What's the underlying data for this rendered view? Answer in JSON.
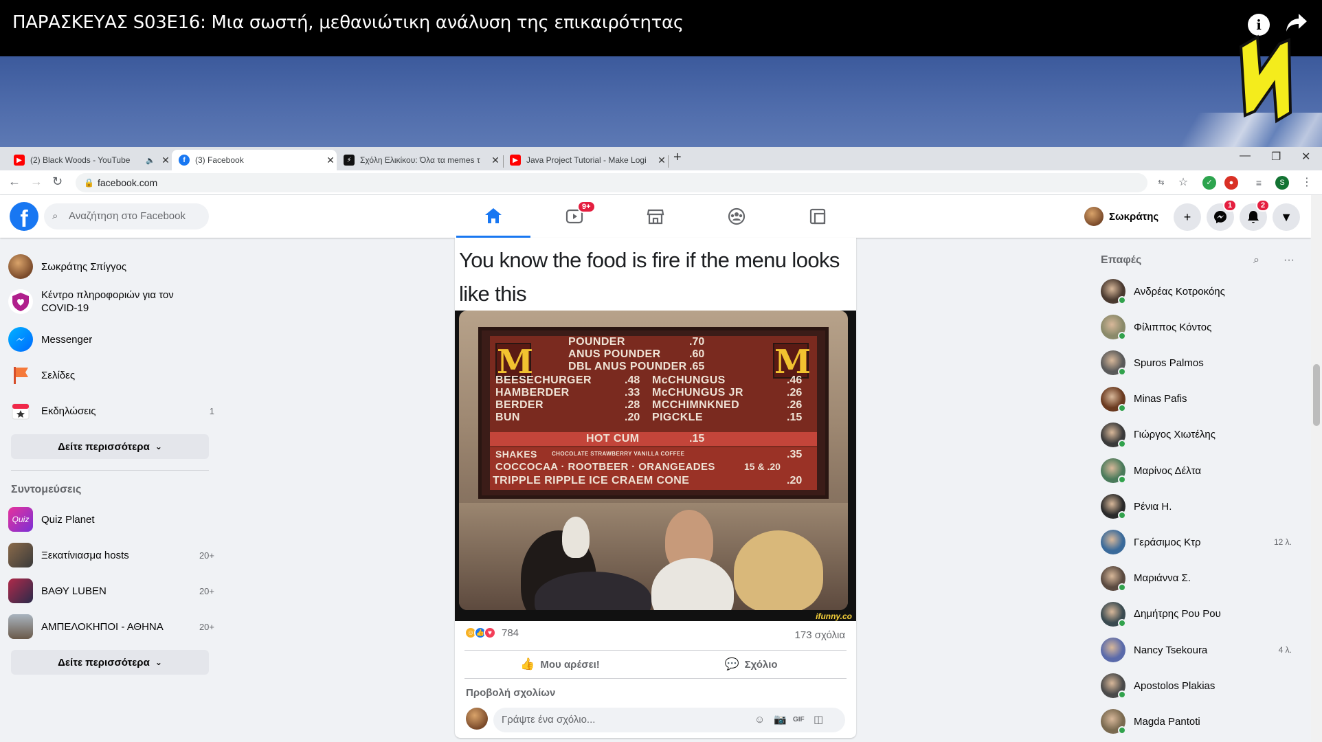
{
  "video": {
    "title": "ΠΑΡΑΣΚΕΥΑΣ S03E16: Μια σωστή, μεθανιώτικη ανάλυση της επικαιρότητας",
    "info_icon": "i",
    "share_icon": "share-arrow"
  },
  "browser": {
    "tabs": [
      {
        "title": "(2) Black Woods - YouTube",
        "icon": "youtube",
        "audio": true
      },
      {
        "title": "(3) Facebook",
        "icon": "facebook",
        "active": true
      },
      {
        "title": "Σχόλη Ελικίκου: Όλα τα memes τ",
        "icon": "bolt"
      },
      {
        "title": "Java Project Tutorial - Make Logi",
        "icon": "youtube"
      }
    ],
    "url": "facebook.com",
    "profile_initial": "S"
  },
  "fb": {
    "search_placeholder": "Αναζήτηση στο Facebook",
    "watch_badge": "9+",
    "profile_name": "Σωκράτης",
    "messenger_badge": "1",
    "notifications_badge": "2"
  },
  "left": {
    "items": [
      {
        "label": "Σωκράτης Σπίγγος"
      },
      {
        "label": "Κέντρο πληροφοριών για τον COVID-19"
      },
      {
        "label": "Messenger"
      },
      {
        "label": "Σελίδες"
      },
      {
        "label": "Εκδηλώσεις",
        "count": "1"
      }
    ],
    "see_more": "Δείτε περισσότερα",
    "shortcuts_title": "Συντομεύσεις",
    "shortcuts": [
      {
        "label": "Quiz Planet",
        "count": ""
      },
      {
        "label": "Ξεκατίνιασμα hosts",
        "count": "20+"
      },
      {
        "label": "ΒΑΘΥ LUBEN",
        "count": "20+"
      },
      {
        "label": "ΑΜΠΕΛΟΚΗΠΟΙ - ΑΘΗΝΑ",
        "count": "20+"
      }
    ],
    "see_more_2": "Δείτε περισσότερα"
  },
  "post": {
    "caption": "You know the food is fire if the menu looks like this",
    "menu": {
      "top": [
        "POUNDER",
        "ANUS POUNDER",
        "DBL ANUS POUNDER"
      ],
      "top_prices": [
        ".70",
        ".60",
        ".65"
      ],
      "left": [
        "BEESECHURGER",
        "HAMBERDER",
        "BERDER",
        "BUN"
      ],
      "left_prices": [
        ".48",
        ".33",
        ".28",
        ".20"
      ],
      "right": [
        "McCHUNGUS",
        "McCHUNGUS JR",
        "MCCHIMNKNED",
        "PIGCKLE"
      ],
      "right_prices": [
        ".46",
        ".26",
        ".26",
        ".15"
      ],
      "hot": "HOT CUM",
      "hot_price": ".15",
      "shakes": "SHAKES",
      "shakes_flavors": "CHOCOLATE  STRAWBERRY  VANILLA  COFFEE",
      "shakes_price": ".35",
      "drinks": "COCCOCAA · ROOTBEER · ORANGEADES",
      "drinks_price": "15 & .20",
      "cone": "TRIPPLE RIPPLE ICE CRAEM CONE",
      "cone_price": ".20"
    },
    "watermark": "ifunny.co",
    "reactions_count": "784",
    "comments_count": "173 σχόλια",
    "like_label": "Μου αρέσει!",
    "comment_label": "Σχόλιο",
    "view_comments": "Προβολή σχολίων",
    "comment_placeholder": "Γράψτε ένα σχόλιο..."
  },
  "contacts": {
    "title": "Επαφές",
    "list": [
      {
        "name": "Ανδρέας Κοτροκόης",
        "meta": "",
        "color": "#4a3a30"
      },
      {
        "name": "Φίλιππος Κόντος",
        "meta": "",
        "color": "#8a8a6a"
      },
      {
        "name": "Spuros Palmos",
        "meta": "",
        "color": "#5a5a5a"
      },
      {
        "name": "Minas Pafis",
        "meta": "",
        "color": "#6a3a20"
      },
      {
        "name": "Γιώργος Χιωτέλης",
        "meta": "",
        "color": "#3a3a3a"
      },
      {
        "name": "Μαρίνος Δέλτα",
        "meta": "",
        "color": "#4a7a5a"
      },
      {
        "name": "Ρένια Η.",
        "meta": "",
        "color": "#2a2a2a"
      },
      {
        "name": "Γεράσιμος Κτρ",
        "meta": "12 λ.",
        "color": "#3a6a9a"
      },
      {
        "name": "Μαριάννα Σ.",
        "meta": "",
        "color": "#5a4a40"
      },
      {
        "name": "Δημήτρης Ρου Ρου",
        "meta": "",
        "color": "#3a4a50"
      },
      {
        "name": "Nancy Tsekoura",
        "meta": "4 λ.",
        "color": "#5a6aaa"
      },
      {
        "name": "Apostolos Plakias",
        "meta": "",
        "color": "#4a4a4a"
      },
      {
        "name": "Magda Pantoti",
        "meta": "",
        "color": "#7a6a50"
      }
    ]
  }
}
